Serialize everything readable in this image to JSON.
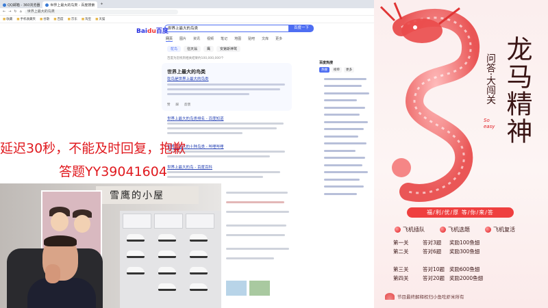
{
  "browser": {
    "tabs": [
      {
        "label": "QQ邮箱 - 360浏览器",
        "active": false
      },
      {
        "label": "世界上最大的鸟类 - 百度搜索",
        "active": true
      }
    ],
    "new_tab": "+",
    "address": "世界上最大的鸟类",
    "bookmarks": [
      "收藏",
      "手机收藏夹",
      "谷歌",
      "百度",
      "京东",
      "淘宝",
      "天猫"
    ]
  },
  "search": {
    "logo_bai": "Bai",
    "logo_du": "du",
    "logo_suffix": "百度",
    "query": "世界上最大的鸟类",
    "button": "百度一下",
    "nav_tabs": [
      "网页",
      "图片",
      "资讯",
      "视频",
      "笔记",
      "地图",
      "贴吧",
      "文库",
      "更多"
    ],
    "chips": [
      "鸵鸟",
      "信天翁",
      "鹰",
      "安第斯神鹫"
    ],
    "hint": "百度为您找到相关结果约100,000,000个",
    "card_title": "世界上最大的鸟类",
    "card_sub": "鸵鸟是世界上最大的鸟类",
    "card_foot": [
      "赞",
      "踩",
      "反馈"
    ],
    "results": [
      "世界上最大的鸟类排名 - 百度知道",
      "世界上最大的十种鸟类 - 哔哩哔哩",
      "世界上最大的鸟 - 百度百科"
    ]
  },
  "hot_list": {
    "title": "百度热搜",
    "tabs": [
      "热搜",
      "榜单",
      "更多"
    ]
  },
  "overlay": {
    "line1": "延迟30秒，不能及时回复，抱歉",
    "line2": "答题YY39041604"
  },
  "camera": {
    "sign": "雪鹰的小屋"
  },
  "panel": {
    "title_main": "龙马精神",
    "title_sub": "问答·大闯关",
    "so_easy": "So easy",
    "banner": "福/利/优/厚 等/你/来/答",
    "options": [
      "飞机插队",
      "飞机选题",
      "飞机复活"
    ],
    "rows": [
      {
        "level": "第一关",
        "task": "答对3题",
        "reward": "奖励100鱼翅"
      },
      {
        "level": "第二关",
        "task": "答对6题",
        "reward": "奖励300鱼翅"
      },
      {
        "level": "第三关",
        "task": "答对10题",
        "reward": "奖励600鱼翅"
      },
      {
        "level": "第四关",
        "task": "答对20题",
        "reward": "奖励2000鱼翅"
      }
    ],
    "footer": "节目最终解释权归小鱼吃虾米所有"
  },
  "colors": {
    "accent_red": "#e0191e",
    "baidu_blue": "#4e6ef2"
  }
}
